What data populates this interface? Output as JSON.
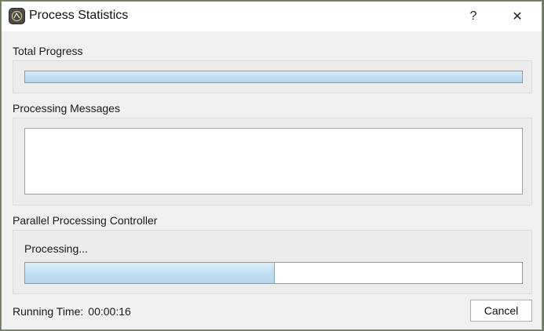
{
  "window": {
    "title": "Process Statistics",
    "help_glyph": "?",
    "close_glyph": "✕",
    "icon": "app-icon"
  },
  "total_progress": {
    "label": "Total Progress",
    "fraction": 1.0
  },
  "messages": {
    "label": "Processing Messages",
    "text": ""
  },
  "controller": {
    "label": "Parallel Processing Controller",
    "status": "Processing...",
    "fraction": 0.5
  },
  "footer": {
    "running_label": "Running Time:",
    "running_value": "00:00:16",
    "cancel_label": "Cancel"
  },
  "colors": {
    "progress_fill": "#c4e0f2",
    "dialog_bg": "#f0f0f0"
  }
}
